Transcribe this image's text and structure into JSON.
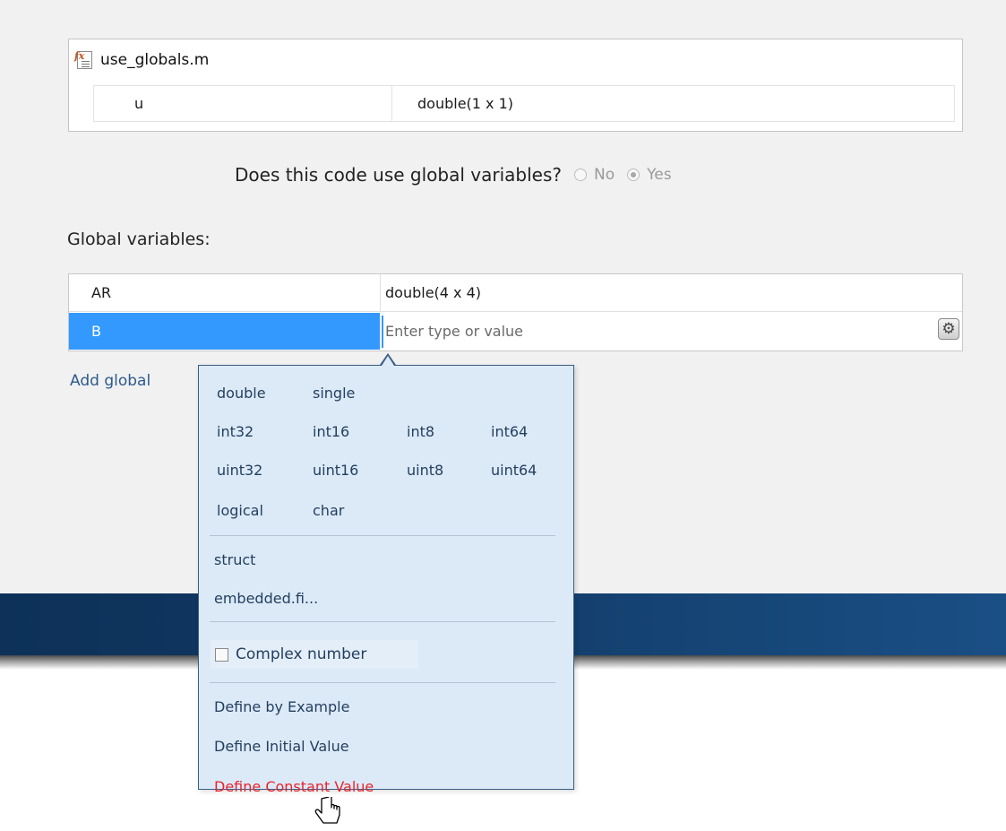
{
  "file_panel": {
    "file_icon": "matlab-function-icon",
    "file_name": "use_globals.m",
    "inputs": [
      {
        "name": "u",
        "type": "double(1 x 1)"
      }
    ]
  },
  "question": {
    "text": "Does this code use global variables?",
    "options": [
      {
        "label": "No",
        "selected": false
      },
      {
        "label": "Yes",
        "selected": true
      }
    ]
  },
  "globals": {
    "label": "Global variables:",
    "rows": [
      {
        "name": "AR",
        "type": "double(4 x 4)"
      },
      {
        "name": "B",
        "type": ""
      }
    ],
    "input_placeholder": "Enter type or value",
    "gear_icon": "gear-icon",
    "add_label": "Add global"
  },
  "popup": {
    "types_row1": [
      "double",
      "single"
    ],
    "types_row2": [
      "int32",
      "int16",
      "int8",
      "int64"
    ],
    "types_row3": [
      "uint32",
      "uint16",
      "uint8",
      "uint64"
    ],
    "types_row4": [
      "logical",
      "char"
    ],
    "struct_label": "struct",
    "fi_label": "embedded.fi...",
    "complex_label": "Complex number",
    "complex_checked": false,
    "define_by_example": "Define by Example",
    "define_initial": "Define Initial Value",
    "define_constant": "Define Constant Value"
  },
  "colors": {
    "selection": "#3399ff",
    "popup_bg": "#dceaf8",
    "popup_border": "#3b5e86",
    "link": "#24405f",
    "hover_red": "#e8232b",
    "band": "#113a66"
  },
  "cursor_icon": "hand-pointer-icon"
}
